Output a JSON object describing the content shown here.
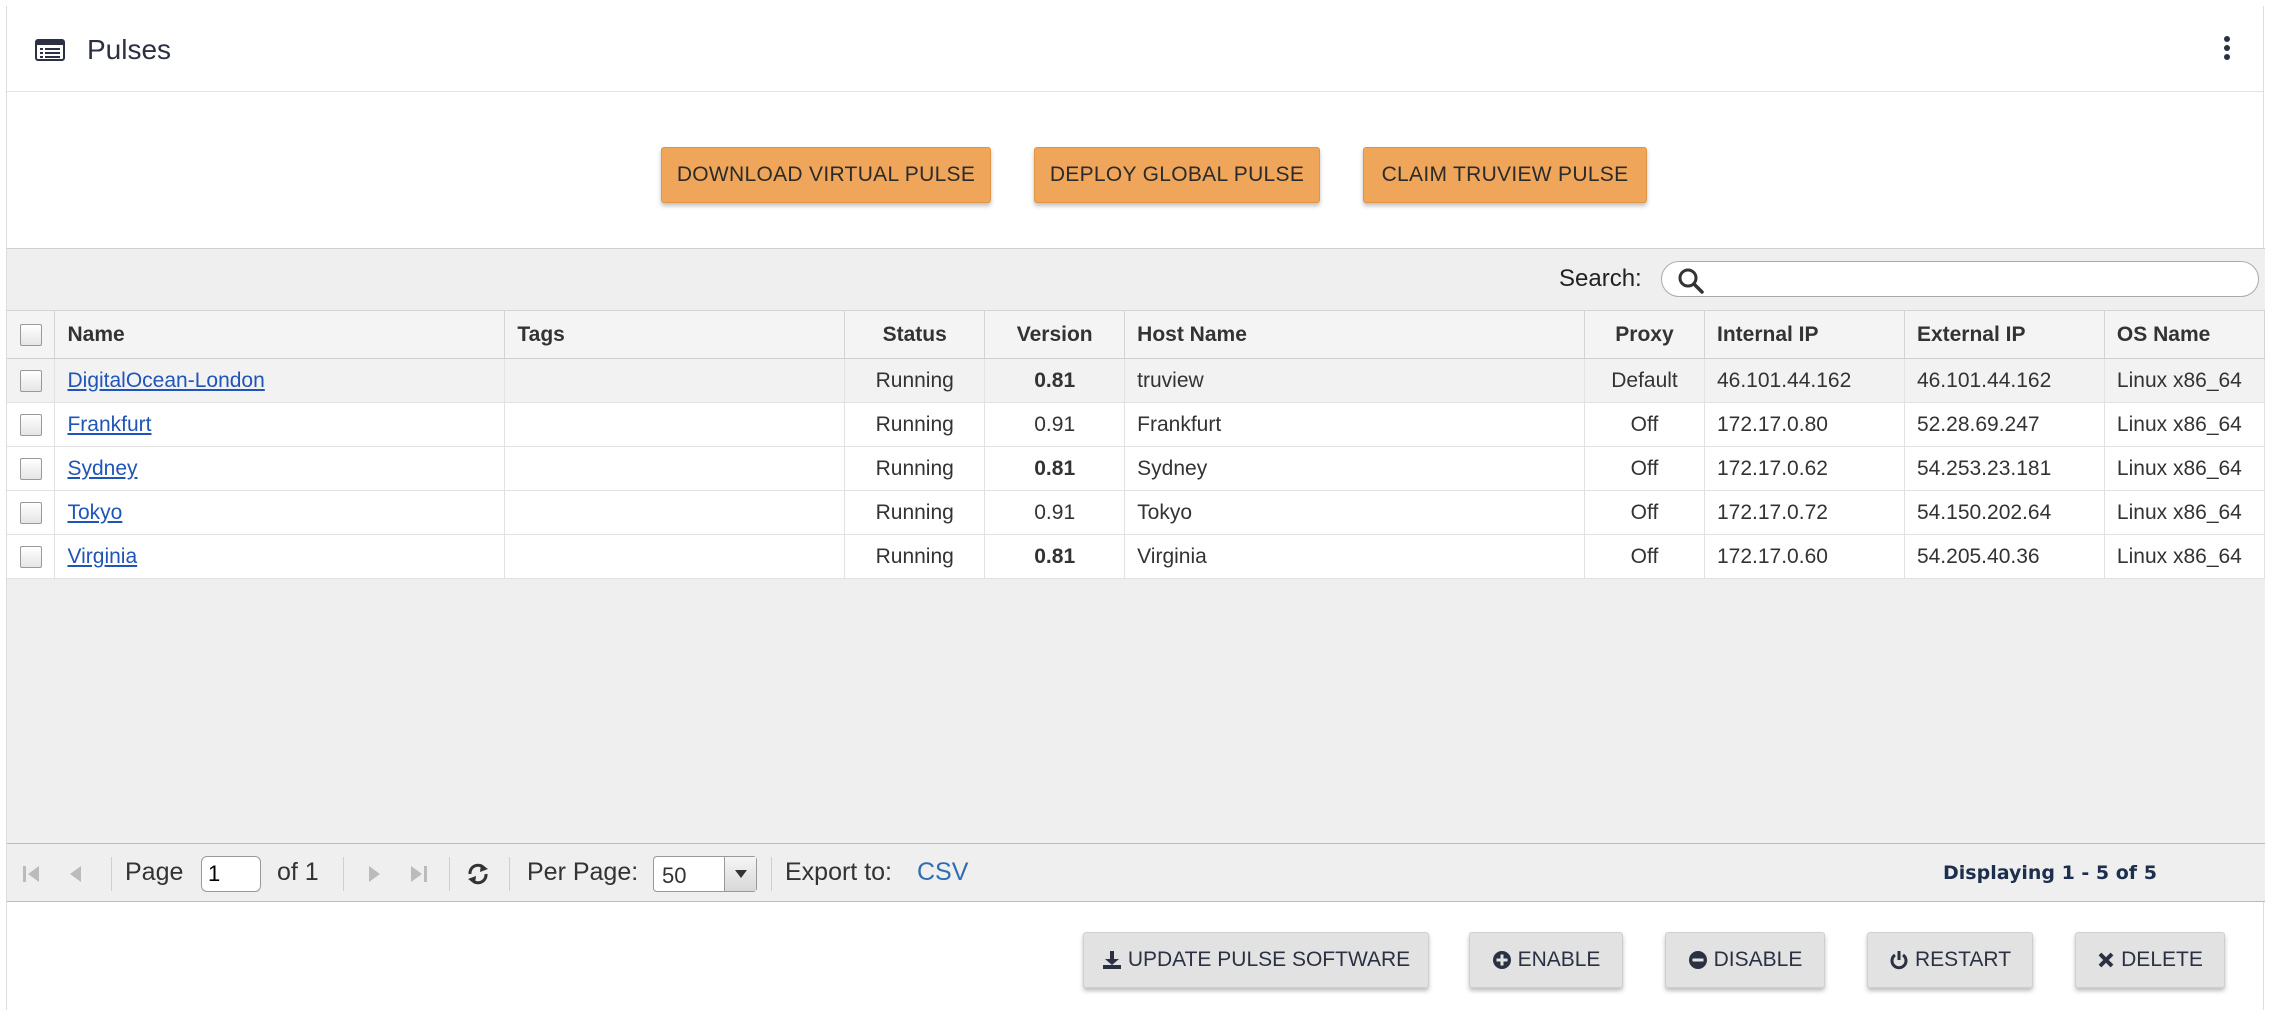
{
  "header": {
    "title": "Pulses",
    "title_icon": "list-icon",
    "menu_icon": "kebab-icon"
  },
  "top_actions": {
    "download": "DOWNLOAD VIRTUAL PULSE",
    "deploy": "DEPLOY GLOBAL PULSE",
    "claim": "CLAIM TRUVIEW PULSE"
  },
  "search": {
    "label": "Search:",
    "value": ""
  },
  "table": {
    "columns": [
      "Name",
      "Tags",
      "Status",
      "Version",
      "Host Name",
      "Proxy",
      "Internal IP",
      "External IP",
      "OS Name"
    ],
    "rows": [
      {
        "name": "DigitalOcean-London",
        "tags": "",
        "status": "Running",
        "version": "0.81",
        "version_bold": true,
        "host": "truview",
        "proxy": "Default",
        "internal_ip": "46.101.44.162",
        "external_ip": "46.101.44.162",
        "os": "Linux x86_64"
      },
      {
        "name": "Frankfurt",
        "tags": "",
        "status": "Running",
        "version": "0.91",
        "version_bold": false,
        "host": "Frankfurt",
        "proxy": "Off",
        "internal_ip": "172.17.0.80",
        "external_ip": "52.28.69.247",
        "os": "Linux x86_64"
      },
      {
        "name": "Sydney",
        "tags": "",
        "status": "Running",
        "version": "0.81",
        "version_bold": true,
        "host": "Sydney",
        "proxy": "Off",
        "internal_ip": "172.17.0.62",
        "external_ip": "54.253.23.181",
        "os": "Linux x86_64"
      },
      {
        "name": "Tokyo",
        "tags": "",
        "status": "Running",
        "version": "0.91",
        "version_bold": false,
        "host": "Tokyo",
        "proxy": "Off",
        "internal_ip": "172.17.0.72",
        "external_ip": "54.150.202.64",
        "os": "Linux x86_64"
      },
      {
        "name": "Virginia",
        "tags": "",
        "status": "Running",
        "version": "0.81",
        "version_bold": true,
        "host": "Virginia",
        "proxy": "Off",
        "internal_ip": "172.17.0.60",
        "external_ip": "54.205.40.36",
        "os": "Linux x86_64"
      }
    ]
  },
  "pager": {
    "page_label": "Page",
    "page_value": "1",
    "of_label": "of 1",
    "per_page_label": "Per Page:",
    "per_page_value": "50",
    "export_label": "Export to:",
    "export_csv": "CSV",
    "displaying": "Displaying 1 - 5 of 5"
  },
  "bottom_actions": {
    "update": "UPDATE PULSE SOFTWARE",
    "enable": "ENABLE",
    "disable": "DISABLE",
    "restart": "RESTART",
    "delete": "DELETE"
  }
}
